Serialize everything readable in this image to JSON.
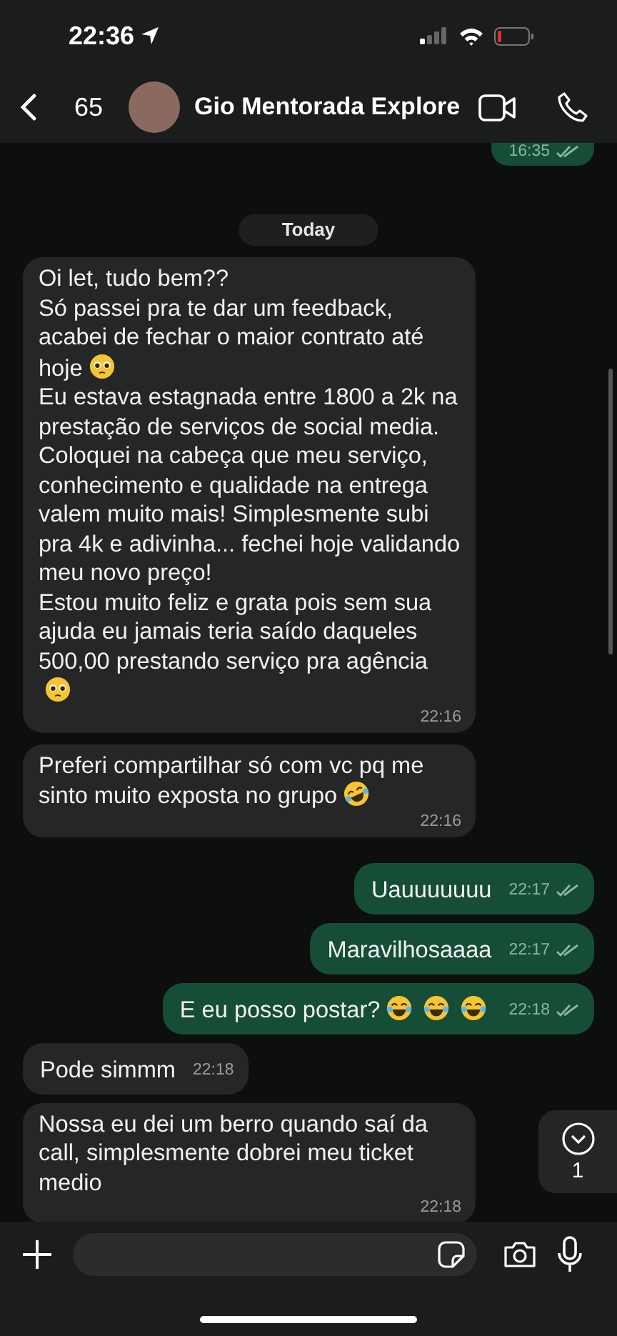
{
  "status_bar": {
    "time": "22:36"
  },
  "header": {
    "back_count": "65",
    "contact_name": "Gio Mentorada Explore"
  },
  "chat": {
    "date_chip": "Today",
    "messages": [
      {
        "sent": true,
        "time": "16:35",
        "delivered": true
      },
      {
        "sent": false,
        "paragraphs": [
          {
            "text": "Oi let, tudo bem??"
          },
          {
            "text": "Só passei pra te dar um feedback, acabei de fechar o maior contrato até hoje",
            "emojis": [
              {
                "kind": "pleading"
              }
            ]
          },
          {
            "text": "Eu estava estagnada entre 1800 a 2k na prestação de serviços de social media. Coloquei na cabeça que meu serviço, conhecimento e qualidade na entrega valem muito mais! Simplesmente subi pra 4k e adivinha... fechei hoje validando meu novo preço!"
          },
          {
            "text": "Estou muito feliz e grata pois sem sua ajuda eu jamais teria saído daqueles 500,00 prestando serviço pra agência",
            "emojis": [
              {
                "kind": "pleading"
              }
            ]
          }
        ],
        "time": "22:16",
        "delivered": false
      },
      {
        "sent": false,
        "paragraphs": [
          {
            "text": "Preferi compartilhar só com vc pq me sinto muito exposta no grupo",
            "emojis": [
              {
                "kind": "rofl"
              }
            ]
          }
        ],
        "time": "22:16",
        "delivered": false
      },
      {
        "sent": true,
        "paragraphs": [
          {
            "text": "Uauuuuuuu"
          }
        ],
        "time": "22:17",
        "delivered": true
      },
      {
        "sent": true,
        "paragraphs": [
          {
            "text": "Maravilhosaaaa"
          }
        ],
        "time": "22:17",
        "delivered": true
      },
      {
        "sent": true,
        "paragraphs": [
          {
            "text": "E eu posso postar?",
            "emojis": [
              {
                "kind": "joy"
              },
              {
                "kind": "joy"
              },
              {
                "kind": "joy"
              }
            ]
          }
        ],
        "time": "22:18",
        "delivered": true
      },
      {
        "sent": false,
        "paragraphs": [
          {
            "text": "Pode simmm"
          }
        ],
        "time": "22:18",
        "delivered": false
      },
      {
        "sent": false,
        "paragraphs": [
          {
            "text": "Nossa eu dei um berro quando saí da call, simplesmente dobrei meu ticket medio"
          }
        ],
        "time": "22:18",
        "delivered": false
      }
    ],
    "unread_count": "1"
  }
}
